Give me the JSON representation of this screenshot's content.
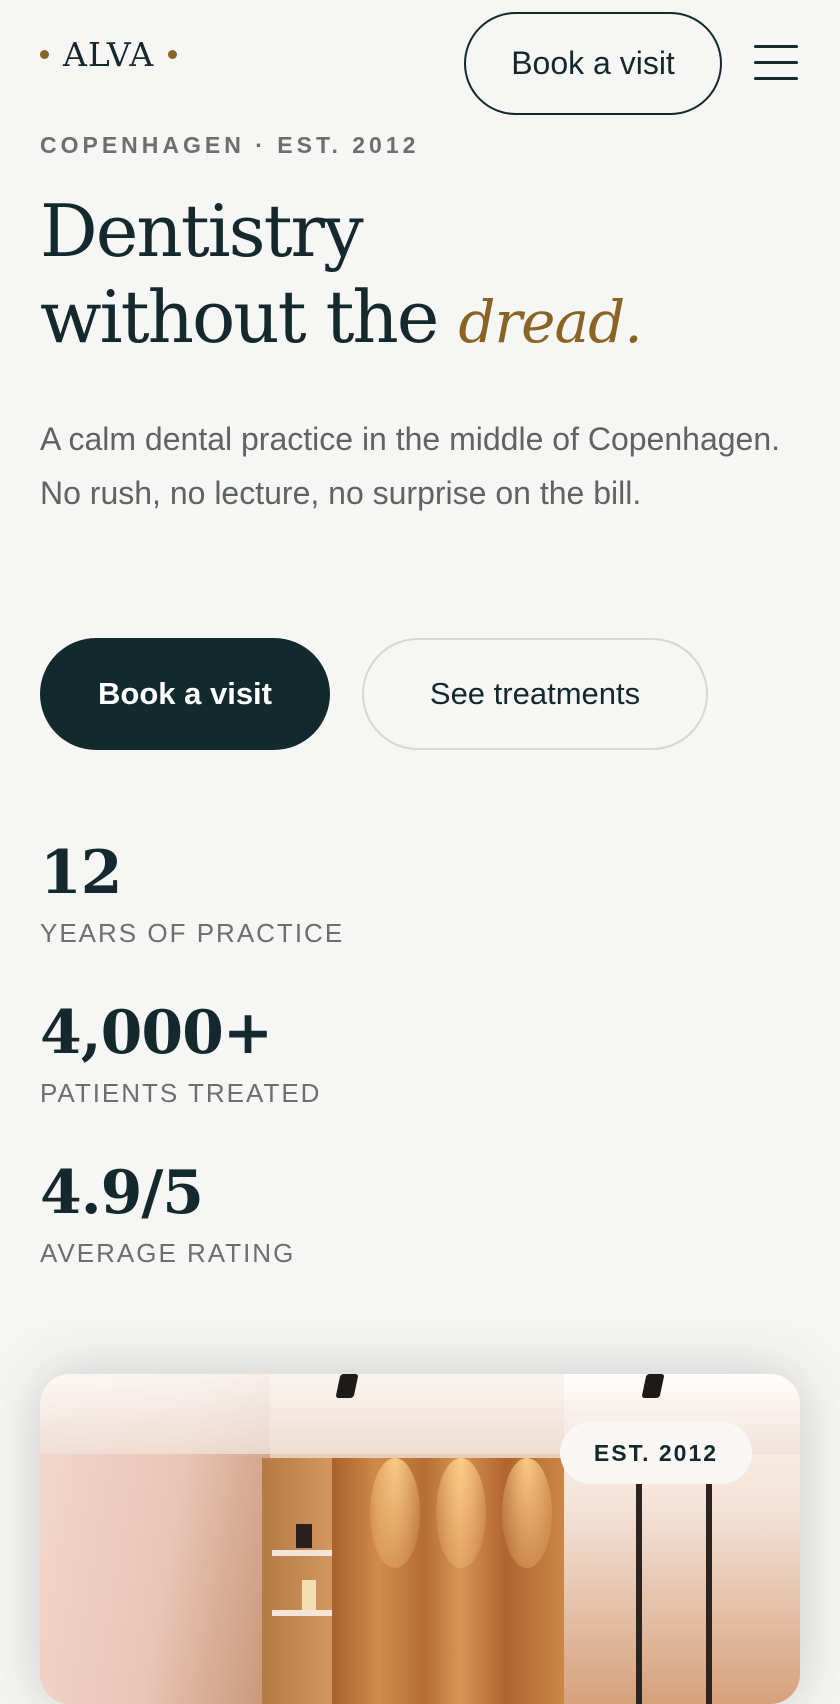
{
  "header": {
    "brand": "ALVA",
    "book_label": "Book a visit",
    "menu_icon": "hamburger-menu-icon"
  },
  "hero": {
    "eyebrow": "COPENHAGEN · EST. 2012",
    "headline_line1": "Dentistry",
    "headline_line2": "without the",
    "headline_accent": "dread.",
    "lede": "A calm dental practice in the middle of Copenhagen. No rush, no lecture, no surprise on the bill.",
    "cta_primary": "Book a visit",
    "cta_secondary": "See treatments"
  },
  "stats": [
    {
      "value": "12",
      "label": "YEARS OF PRACTICE"
    },
    {
      "value": "4,000+",
      "label": "PATIENTS TREATED"
    },
    {
      "value": "4.9/5",
      "label": "AVERAGE RATING"
    }
  ],
  "photo": {
    "badge": "EST. 2012"
  },
  "colors": {
    "background": "#f6f6f4",
    "ink": "#14292d",
    "accent": "#8a6424",
    "muted": "#6b6f6e"
  }
}
